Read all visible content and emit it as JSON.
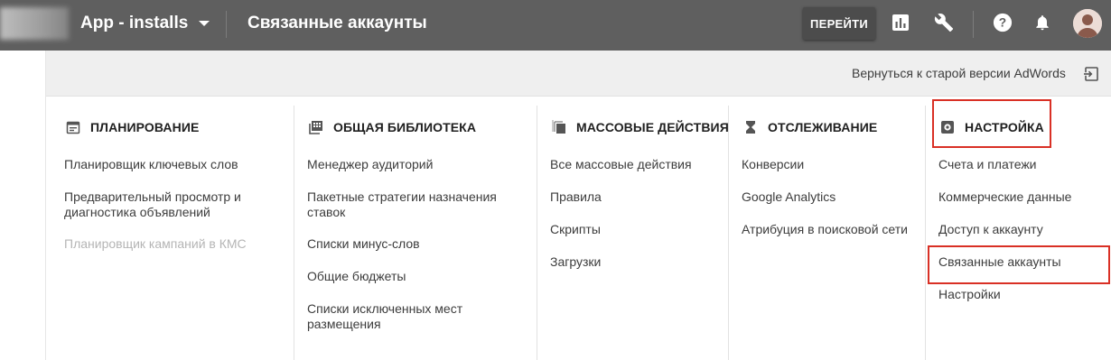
{
  "topbar": {
    "campaign": "App - installs",
    "title": "Связанные аккаунты",
    "go_label": "ПЕРЕЙТИ",
    "icons": [
      "reports-icon",
      "tools-icon",
      "help-icon",
      "notifications-icon",
      "avatar"
    ]
  },
  "strip": {
    "back_link": "Вернуться к старой версии AdWords"
  },
  "columns": [
    {
      "heading": "ПЛАНИРОВАНИЕ",
      "icon": "calendar-icon",
      "items": [
        "Планировщик ключевых слов",
        "Предварительный просмотр и диагностика объявлений",
        "Планировщик кампаний в КМС"
      ],
      "disabled_items": [
        "Планировщик кампаний в КМС"
      ]
    },
    {
      "heading": "ОБЩАЯ БИБЛИОТЕКА",
      "icon": "library-icon",
      "items": [
        "Менеджер аудиторий",
        "Пакетные стратегии назначения ставок",
        "Списки минус-слов",
        "Общие бюджеты",
        "Списки исключенных мест размещения"
      ]
    },
    {
      "heading": "МАССОВЫЕ ДЕЙСТВИЯ",
      "icon": "bulk-actions-icon",
      "items": [
        "Все массовые действия",
        "Правила",
        "Скрипты",
        "Загрузки"
      ]
    },
    {
      "heading": "ОТСЛЕЖИВАНИЕ",
      "icon": "hourglass-icon",
      "items": [
        "Конверсии",
        "Google Analytics",
        "Атрибуция в поисковой сети"
      ]
    },
    {
      "heading": "НАСТРОЙКА",
      "icon": "settings-icon",
      "items": [
        "Счета и платежи",
        "Коммерческие данные",
        "Доступ к аккаунту",
        "Связанные аккаунты",
        "Настройки"
      ]
    }
  ],
  "colors": {
    "topbar": "#5f5f5f",
    "strip": "#efefef",
    "highlight": "#d93025",
    "disabled_text": "#b5b5b5"
  }
}
